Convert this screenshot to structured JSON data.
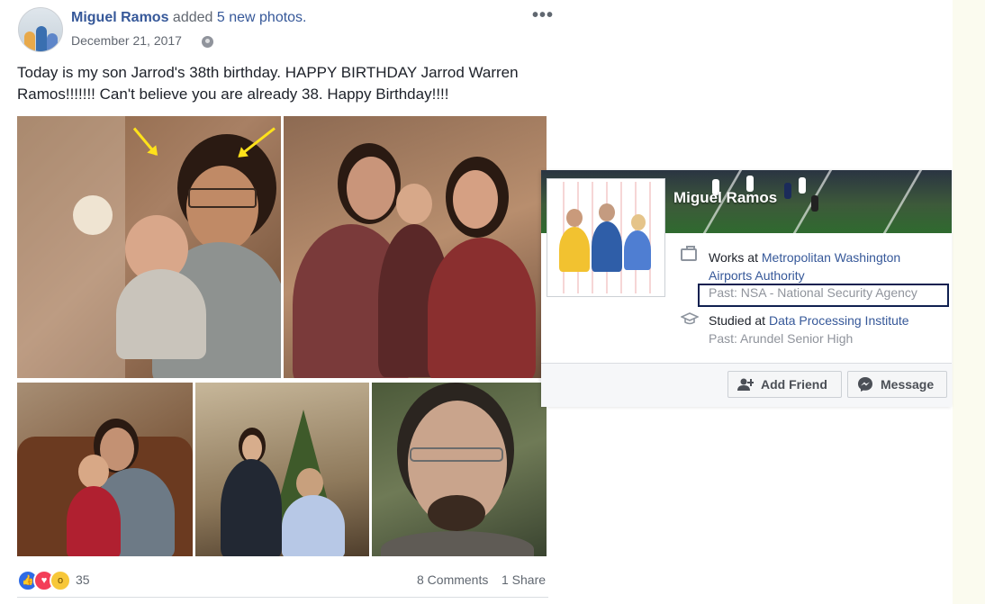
{
  "post": {
    "author": "Miguel Ramos",
    "action": "added",
    "photos_link": "5 new photos.",
    "date": "December 21, 2017",
    "text": "Today is my son Jarrod's 38th birthday. HAPPY BIRTHDAY Jarrod Warren Ramos!!!!!!! Can't believe you are already 38. Happy Birthday!!!!",
    "reaction_count": "35",
    "comments": "8 Comments",
    "shares": "1 Share"
  },
  "hover_card": {
    "name": "Miguel Ramos",
    "works_prefix": "Works at",
    "works_org": "Metropolitan Washington Airports Authority",
    "works_past": "Past: NSA - National Security Agency",
    "studied_prefix": "Studied at",
    "studied_org": "Data Processing Institute",
    "studied_past": "Past: Arundel Senior High",
    "add_friend_label": "Add Friend",
    "message_label": "Message"
  },
  "icons": {
    "more": "more-options-icon",
    "privacy": "globe-icon",
    "work": "briefcase-icon",
    "education": "graduation-cap-icon",
    "add_friend": "add-friend-icon",
    "message": "messenger-icon",
    "reactions": [
      "like-icon",
      "love-icon",
      "wow-icon"
    ]
  },
  "colors": {
    "link": "#365899",
    "highlight_border": "#102050",
    "arrow": "#ffe21a"
  }
}
